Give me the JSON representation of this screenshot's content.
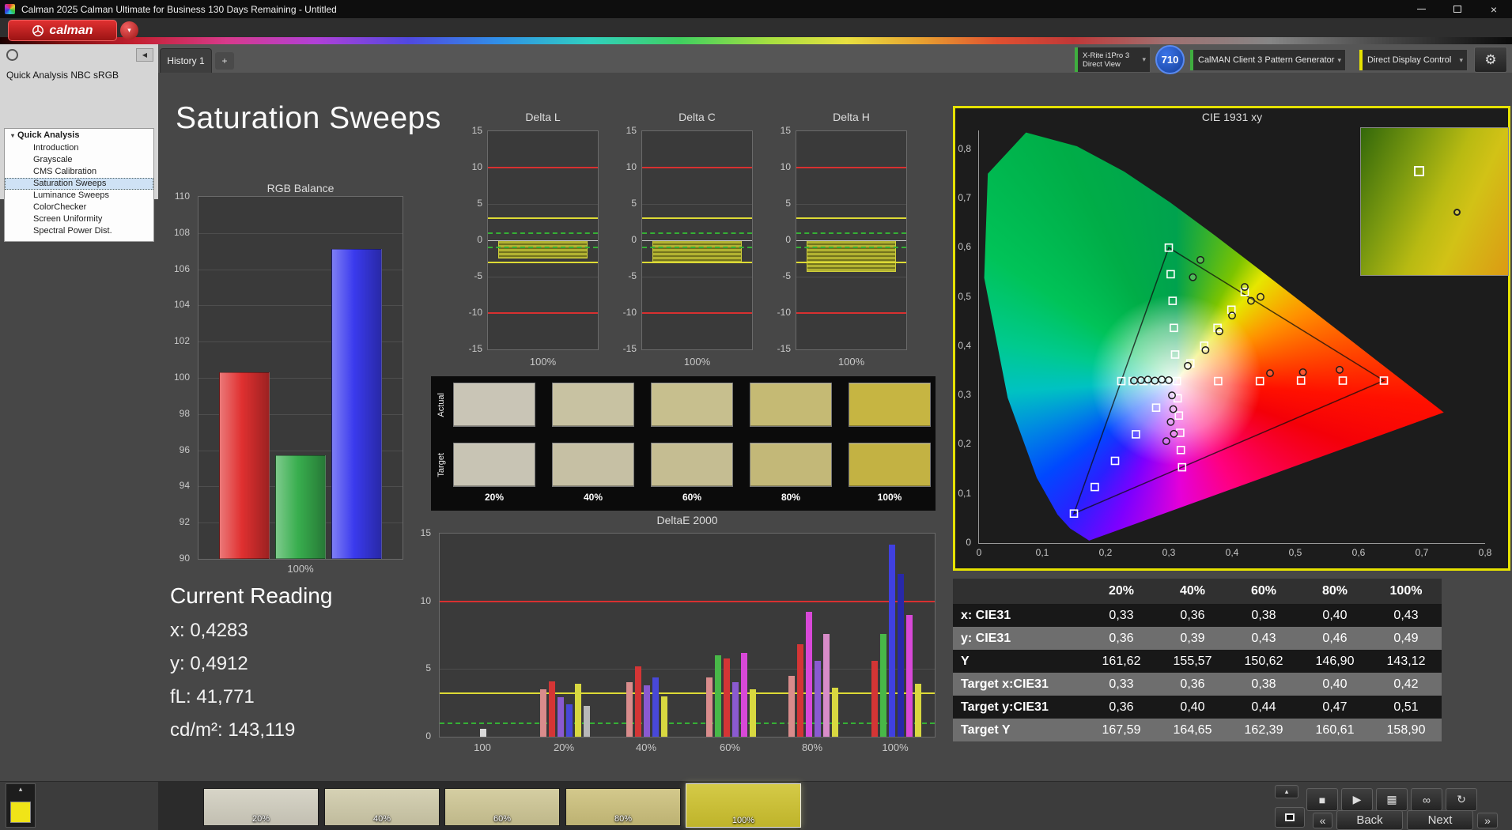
{
  "window": {
    "title": "Calman 2025 Calman Ultimate for Business 130 Days Remaining  - Untitled",
    "brand": "calman"
  },
  "icons": {
    "dropdown-arrow": "▾",
    "gear": "⚙",
    "collapse-left": "◀",
    "tree-expand": "▾",
    "stop": "■",
    "play": "▶",
    "save": "▦",
    "link": "∞",
    "refresh": "↻",
    "eject": "▴",
    "chevron-left": "«",
    "chevron-right": "»",
    "add": "+"
  },
  "tabs": {
    "history": "History 1",
    "add": "+"
  },
  "devices": {
    "meter": {
      "line1": "X-Rite i1Pro 3",
      "line2": "Direct View"
    },
    "badge": "710",
    "source": {
      "label": "CalMAN Client 3 Pattern Generator"
    },
    "display": {
      "label": "Direct Display Control"
    }
  },
  "sidebar": {
    "title": "Quick Analysis NBC sRGB",
    "root": "Quick Analysis",
    "items": [
      "Introduction",
      "Grayscale",
      "CMS Calibration",
      "Saturation Sweeps",
      "Luminance Sweeps",
      "ColorChecker",
      "Screen Uniformity",
      "Spectral Power Dist."
    ],
    "selected_index": 3
  },
  "page": {
    "title": "Saturation Sweeps"
  },
  "current_reading": {
    "title": "Current Reading",
    "lines": [
      "x: 0,4283",
      "y: 0,4912",
      "fL: 41,771",
      "cd/m²: 143,119"
    ]
  },
  "patch_rows": {
    "row_labels": [
      "Actual",
      "Target"
    ],
    "col_labels": [
      "20%",
      "40%",
      "60%",
      "80%",
      "100%"
    ],
    "actual": [
      "#c9c5b6",
      "#c8c2a2",
      "#c7bf8e",
      "#c5ba74",
      "#c6b542"
    ],
    "target": [
      "#c8c4b4",
      "#c6c0a4",
      "#c5bd92",
      "#c3b878",
      "#c3b243"
    ]
  },
  "table": {
    "header": [
      "",
      "20%",
      "40%",
      "60%",
      "80%",
      "100%"
    ],
    "rows": [
      {
        "label": "x: CIE31",
        "values": [
          "0,33",
          "0,36",
          "0,38",
          "0,40",
          "0,43"
        ]
      },
      {
        "label": "y: CIE31",
        "values": [
          "0,36",
          "0,39",
          "0,43",
          "0,46",
          "0,49"
        ]
      },
      {
        "label": "Y",
        "values": [
          "161,62",
          "155,57",
          "150,62",
          "146,90",
          "143,12"
        ]
      },
      {
        "label": "Target x:CIE31",
        "values": [
          "0,33",
          "0,36",
          "0,38",
          "0,40",
          "0,42"
        ]
      },
      {
        "label": "Target y:CIE31",
        "values": [
          "0,36",
          "0,40",
          "0,44",
          "0,47",
          "0,51"
        ]
      },
      {
        "label": "Target Y",
        "values": [
          "167,59",
          "164,65",
          "162,39",
          "160,61",
          "158,90"
        ]
      }
    ]
  },
  "bottom": {
    "swatch_color": "#f0e418",
    "thumbs": [
      {
        "label": "20%",
        "color": "#d2cfc0",
        "selected": false
      },
      {
        "label": "40%",
        "color": "#d0cbaa",
        "selected": false
      },
      {
        "label": "60%",
        "color": "#cfc795",
        "selected": false
      },
      {
        "label": "80%",
        "color": "#cdc17c",
        "selected": false
      },
      {
        "label": "100%",
        "color": "#cfc32e",
        "selected": true
      }
    ],
    "back_label": "Back",
    "next_label": "Next"
  },
  "chart_data": [
    {
      "id": "rgb_balance",
      "type": "bar",
      "title": "RGB Balance",
      "categories": [
        "Red",
        "Green",
        "Blue"
      ],
      "values": [
        100.3,
        95.7,
        107.1
      ],
      "colors": [
        "#e03030",
        "#38ae4e",
        "#3a3aee"
      ],
      "ylim": [
        90,
        110
      ],
      "yticks": [
        110,
        108,
        106,
        104,
        102,
        100,
        98,
        96,
        94,
        92,
        90
      ],
      "xlabel": "100%",
      "ylabel": ""
    },
    {
      "id": "delta_sweeps",
      "type": "bar",
      "charts": [
        {
          "title": "Delta L",
          "value": -2.5
        },
        {
          "title": "Delta C",
          "value": -3.2
        },
        {
          "title": "Delta H",
          "value": -4.3
        }
      ],
      "ylim": [
        -15,
        15
      ],
      "yticks": [
        15,
        10,
        5,
        0,
        -5,
        -10,
        -15
      ],
      "ref_lines": {
        "red": [
          10,
          -10
        ],
        "yellow": [
          3,
          -3
        ],
        "green": [
          1,
          -1
        ]
      },
      "xlabel": "100%"
    },
    {
      "id": "deltae_2000",
      "type": "bar",
      "title": "DeltaE 2000",
      "ylim": [
        0,
        15
      ],
      "yticks": [
        0,
        5,
        10,
        15
      ],
      "ref_lines": {
        "red": 10,
        "yellow": 3.2,
        "green": 1
      },
      "group_centers": [
        55,
        158,
        262,
        368,
        472,
        577
      ],
      "groups": [
        {
          "label": "100",
          "bars": [
            [
              "#d8d8d8",
              0.6
            ]
          ]
        },
        {
          "label": "20%",
          "bars": [
            [
              "#d98c8c",
              3.5
            ],
            [
              "#d43535",
              4.1
            ],
            [
              "#8a5ad0",
              2.9
            ],
            [
              "#4848d8",
              2.4
            ],
            [
              "#d8d840",
              3.9
            ],
            [
              "#b8b8b8",
              2.3
            ]
          ]
        },
        {
          "label": "40%",
          "bars": [
            [
              "#d98c8c",
              4.0
            ],
            [
              "#d43535",
              5.2
            ],
            [
              "#8a5ad0",
              3.8
            ],
            [
              "#4848d8",
              4.4
            ],
            [
              "#d8d840",
              3.0
            ]
          ]
        },
        {
          "label": "60%",
          "bars": [
            [
              "#d98c8c",
              4.4
            ],
            [
              "#48b848",
              6.0
            ],
            [
              "#d43535",
              5.8
            ],
            [
              "#8a5ad0",
              4.0
            ],
            [
              "#d848d8",
              6.2
            ],
            [
              "#d8d840",
              3.5
            ]
          ]
        },
        {
          "label": "80%",
          "bars": [
            [
              "#d98c8c",
              4.5
            ],
            [
              "#d43535",
              6.8
            ],
            [
              "#d848d8",
              9.2
            ],
            [
              "#8a5ad0",
              5.6
            ],
            [
              "#d88cc8",
              7.6
            ],
            [
              "#d8d840",
              3.6
            ]
          ]
        },
        {
          "label": "100%",
          "bars": [
            [
              "#d43535",
              5.6
            ],
            [
              "#48b848",
              7.6
            ],
            [
              "#4040e0",
              14.2
            ],
            [
              "#2828a8",
              12.0
            ],
            [
              "#d848d8",
              9.0
            ],
            [
              "#d8d840",
              3.9
            ]
          ]
        }
      ]
    },
    {
      "id": "cie_1931",
      "type": "scatter",
      "title": "CIE 1931 xy",
      "xticks": [
        "0",
        "0,1",
        "0,2",
        "0,3",
        "0,4",
        "0,5",
        "0,6",
        "0,7",
        "0,8"
      ],
      "yticks": [
        "0",
        "0,1",
        "0,2",
        "0,3",
        "0,4",
        "0,5",
        "0,6",
        "0,7",
        "0,8"
      ],
      "xlim": [
        0,
        0.8
      ],
      "ylim": [
        0,
        0.838
      ],
      "locus": [
        [
          0.1741,
          0.005
        ],
        [
          0.144,
          0.0297
        ],
        [
          0.1241,
          0.0578
        ],
        [
          0.0913,
          0.1327
        ],
        [
          0.0454,
          0.295
        ],
        [
          0.0082,
          0.5384
        ],
        [
          0.0139,
          0.7502
        ],
        [
          0.0743,
          0.8338
        ],
        [
          0.1547,
          0.8059
        ],
        [
          0.2296,
          0.7543
        ],
        [
          0.3016,
          0.6923
        ],
        [
          0.3731,
          0.6245
        ],
        [
          0.4441,
          0.5547
        ],
        [
          0.5125,
          0.4866
        ],
        [
          0.5752,
          0.4242
        ],
        [
          0.627,
          0.3725
        ],
        [
          0.6915,
          0.3083
        ],
        [
          0.7347,
          0.2653
        ]
      ],
      "srgb_triangle": [
        [
          0.64,
          0.33
        ],
        [
          0.3,
          0.6
        ],
        [
          0.15,
          0.06
        ]
      ],
      "target_points": [
        [
          0.3127,
          0.329
        ],
        [
          0.378,
          0.329
        ],
        [
          0.444,
          0.329
        ],
        [
          0.509,
          0.33
        ],
        [
          0.575,
          0.33
        ],
        [
          0.64,
          0.33
        ],
        [
          0.31,
          0.383
        ],
        [
          0.308,
          0.437
        ],
        [
          0.306,
          0.492
        ],
        [
          0.303,
          0.546
        ],
        [
          0.3,
          0.6
        ],
        [
          0.28,
          0.275
        ],
        [
          0.248,
          0.221
        ],
        [
          0.215,
          0.167
        ],
        [
          0.183,
          0.114
        ],
        [
          0.15,
          0.06
        ],
        [
          0.295,
          0.329
        ],
        [
          0.278,
          0.329
        ],
        [
          0.26,
          0.329
        ],
        [
          0.243,
          0.329
        ],
        [
          0.225,
          0.329
        ],
        [
          0.314,
          0.294
        ],
        [
          0.316,
          0.259
        ],
        [
          0.318,
          0.224
        ],
        [
          0.319,
          0.189
        ],
        [
          0.321,
          0.154
        ],
        [
          0.334,
          0.365
        ],
        [
          0.356,
          0.401
        ],
        [
          0.377,
          0.437
        ],
        [
          0.399,
          0.474
        ],
        [
          0.42,
          0.51
        ]
      ],
      "measured_points": [
        [
          0.33,
          0.36
        ],
        [
          0.358,
          0.392
        ],
        [
          0.38,
          0.43
        ],
        [
          0.4,
          0.462
        ],
        [
          0.43,
          0.492
        ],
        [
          0.245,
          0.33
        ],
        [
          0.256,
          0.331
        ],
        [
          0.267,
          0.332
        ],
        [
          0.278,
          0.33
        ],
        [
          0.289,
          0.332
        ],
        [
          0.3,
          0.331
        ],
        [
          0.46,
          0.345
        ],
        [
          0.512,
          0.347
        ],
        [
          0.57,
          0.352
        ],
        [
          0.305,
          0.3
        ],
        [
          0.307,
          0.272
        ],
        [
          0.303,
          0.246
        ],
        [
          0.308,
          0.222
        ],
        [
          0.296,
          0.207
        ],
        [
          0.35,
          0.575
        ],
        [
          0.338,
          0.54
        ],
        [
          0.42,
          0.52
        ],
        [
          0.445,
          0.5
        ]
      ]
    }
  ]
}
